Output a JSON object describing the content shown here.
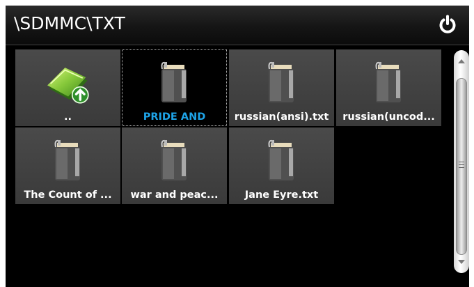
{
  "header": {
    "path": "\\SDMMC\\TXT",
    "power_icon": "power-icon"
  },
  "files": [
    {
      "label": "..",
      "icon": "folder-up-icon",
      "selected": false
    },
    {
      "label": "PRIDE AND",
      "icon": "book-icon",
      "selected": true
    },
    {
      "label": "russian(ansi).txt",
      "icon": "book-icon",
      "selected": false
    },
    {
      "label": "russian(uncod...",
      "icon": "book-icon",
      "selected": false
    },
    {
      "label": "The Count of ...",
      "icon": "book-icon",
      "selected": false
    },
    {
      "label": "war and peac...",
      "icon": "book-icon",
      "selected": false
    },
    {
      "label": "Jane Eyre.txt",
      "icon": "book-icon",
      "selected": false
    }
  ],
  "scrollbar": {
    "up_icon": "chevron-up-icon",
    "down_icon": "chevron-down-icon"
  },
  "colors": {
    "background": "#000000",
    "tile": "#444444",
    "selected_label": "#1ea4e8",
    "label": "#ffffff"
  }
}
